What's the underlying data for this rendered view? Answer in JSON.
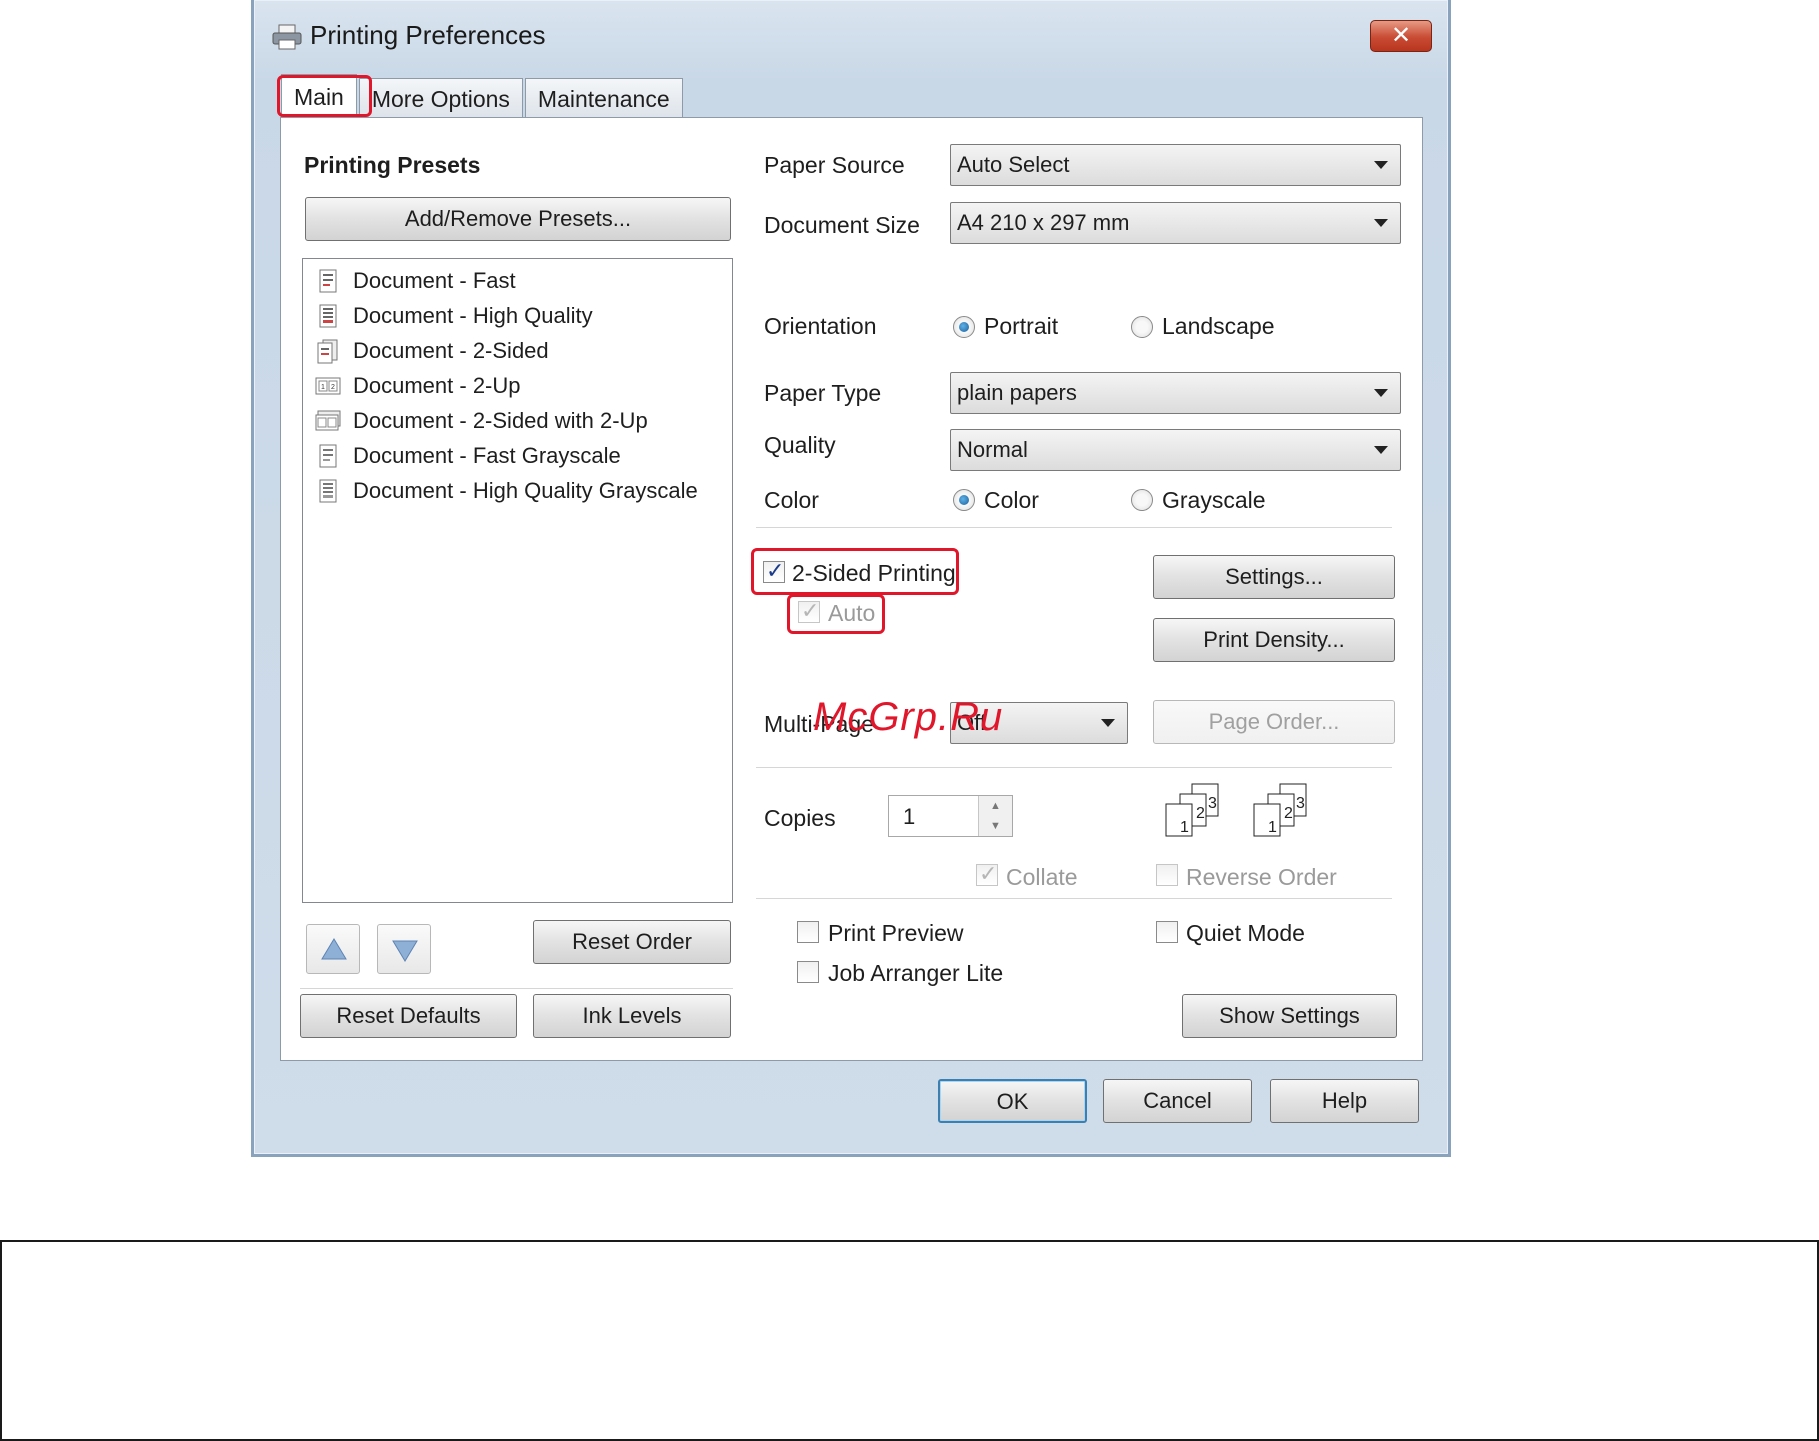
{
  "window": {
    "title": "Printing Preferences",
    "close": "✕"
  },
  "tabs": [
    {
      "label": "Main",
      "active": true
    },
    {
      "label": "More Options"
    },
    {
      "label": "Maintenance"
    }
  ],
  "presets": {
    "title": "Printing Presets",
    "add_remove": "Add/Remove Presets...",
    "items": [
      {
        "label": "Document - Fast",
        "icon": "document-fast-icon"
      },
      {
        "label": "Document - High Quality",
        "icon": "document-high-quality-icon"
      },
      {
        "label": "Document - 2-Sided",
        "icon": "document-2-sided-icon"
      },
      {
        "label": "Document - 2-Up",
        "icon": "document-2-up-icon"
      },
      {
        "label": "Document - 2-Sided with 2-Up",
        "icon": "document-2-sided-2-up-icon"
      },
      {
        "label": "Document - Fast Grayscale",
        "icon": "document-fast-grayscale-icon"
      },
      {
        "label": "Document - High Quality Grayscale",
        "icon": "document-hq-grayscale-icon"
      }
    ],
    "reset_order": "Reset Order",
    "reset_defaults": "Reset Defaults",
    "ink_levels": "Ink Levels"
  },
  "settings": {
    "paper_source": {
      "label": "Paper Source",
      "value": "Auto Select"
    },
    "document_size": {
      "label": "Document Size",
      "value": "A4 210 x 297 mm"
    },
    "orientation": {
      "label": "Orientation",
      "options": [
        "Portrait",
        "Landscape"
      ],
      "selected": "Portrait"
    },
    "paper_type": {
      "label": "Paper Type",
      "value": "plain papers"
    },
    "quality": {
      "label": "Quality",
      "value": "Normal"
    },
    "color": {
      "label": "Color",
      "options": [
        "Color",
        "Grayscale"
      ],
      "selected": "Color"
    },
    "two_sided": {
      "label": "2-Sided Printing",
      "checked": true
    },
    "auto": {
      "label": "Auto",
      "checked": true,
      "enabled": false
    },
    "settings_button": "Settings...",
    "print_density_button": "Print Density...",
    "multi_page": {
      "label": "Multi-Page",
      "value": "Off"
    },
    "page_order_button": "Page Order...",
    "copies": {
      "label": "Copies",
      "value": "1"
    },
    "collate": {
      "label": "Collate",
      "checked": true,
      "enabled": false
    },
    "reverse_order": {
      "label": "Reverse Order",
      "checked": false,
      "enabled": false
    },
    "print_preview": {
      "label": "Print Preview",
      "checked": false
    },
    "quiet_mode": {
      "label": "Quiet Mode",
      "checked": false
    },
    "job_arranger": {
      "label": "Job Arranger Lite",
      "checked": false
    },
    "show_settings_button": "Show Settings"
  },
  "footer": {
    "ok": "OK",
    "cancel": "Cancel",
    "help": "Help"
  },
  "watermark": "McGrp.Ru",
  "colors": {
    "highlight": "#e0162b",
    "accent": "#3c7fb1"
  }
}
